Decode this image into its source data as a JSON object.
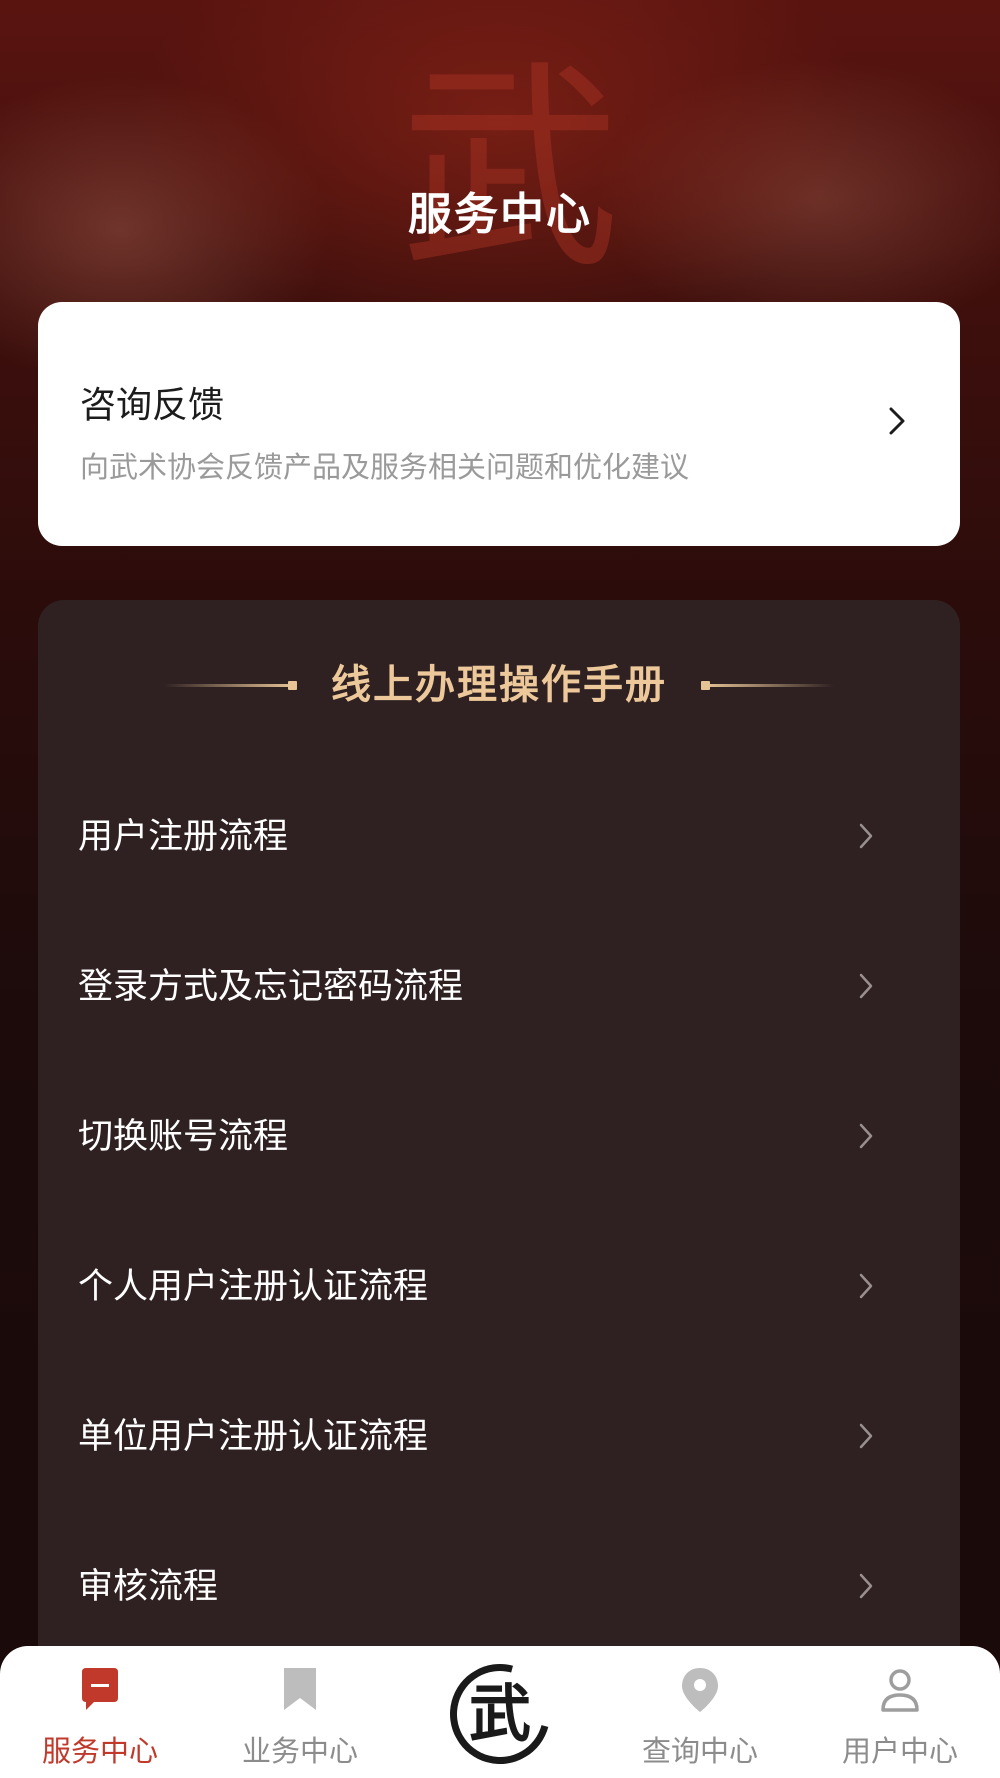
{
  "header": {
    "title": "服务中心",
    "background_char": "武"
  },
  "feedback": {
    "title": "咨询反馈",
    "description": "向武术协会反馈产品及服务相关问题和优化建议"
  },
  "manual": {
    "title": "线上办理操作手册",
    "items": [
      {
        "label": "用户注册流程"
      },
      {
        "label": "登录方式及忘记密码流程"
      },
      {
        "label": "切换账号流程"
      },
      {
        "label": "个人用户注册认证流程"
      },
      {
        "label": "单位用户注册认证流程"
      },
      {
        "label": "审核流程"
      }
    ]
  },
  "tabbar": {
    "tabs": [
      {
        "label": "服务中心",
        "icon": "chat-bubble-icon",
        "active": true
      },
      {
        "label": "业务中心",
        "icon": "bookmark-icon",
        "active": false
      },
      {
        "label": "查询中心",
        "icon": "location-pin-icon",
        "active": false
      },
      {
        "label": "用户中心",
        "icon": "user-icon",
        "active": false
      }
    ],
    "center_logo_char": "武"
  },
  "colors": {
    "accent": "#c0392b",
    "gold": "#ecc89a",
    "panel": "#2f2122",
    "inactive": "#8c8c8c"
  }
}
